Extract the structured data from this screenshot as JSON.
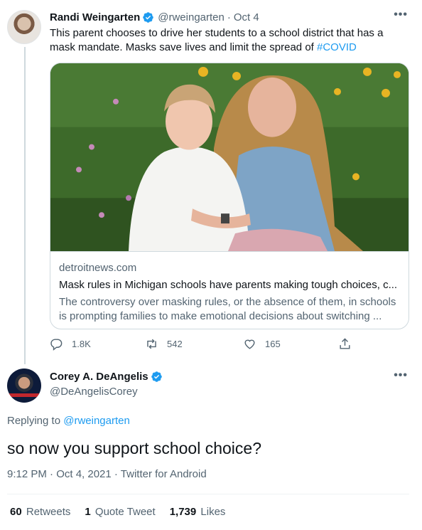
{
  "tweet1": {
    "author_name": "Randi Weingarten",
    "handle": "@rweingarten",
    "separator": "·",
    "date": "Oct 4",
    "text_before_hashtag": "This parent chooses to drive her students to a school district that has a mask mandate. Masks save lives and limit the spread of ",
    "hashtag": "#COVID",
    "card": {
      "domain": "detroitnews.com",
      "title": "Mask rules in Michigan schools have parents making tough choices, c...",
      "description": "The controversy over masking rules, or the absence of them, in schools is prompting families to make emotional decisions about switching ..."
    },
    "actions": {
      "replies": "1.8K",
      "retweets": "542",
      "likes": "165"
    }
  },
  "tweet2": {
    "author_name": "Corey A. DeAngelis",
    "handle": "@DeAngelisCorey",
    "replying_prefix": "Replying to",
    "replying_to": "@rweingarten",
    "text": "so now you support school choice?",
    "meta": "9:12 PM · Oct 4, 2021 · Twitter for Android",
    "stats": {
      "retweets_count": "60",
      "retweets_label": "Retweets",
      "quotes_count": "1",
      "quotes_label": "Quote Tweet",
      "likes_count": "1,739",
      "likes_label": "Likes"
    }
  },
  "icons": {
    "verified": "verified-badge-icon",
    "more": "more-icon",
    "reply": "reply-icon",
    "retweet": "retweet-icon",
    "like": "heart-icon",
    "share": "share-icon"
  },
  "colors": {
    "accent": "#1d9bf0",
    "text": "#0f1419",
    "muted": "#536471",
    "border": "#cfd9de"
  }
}
